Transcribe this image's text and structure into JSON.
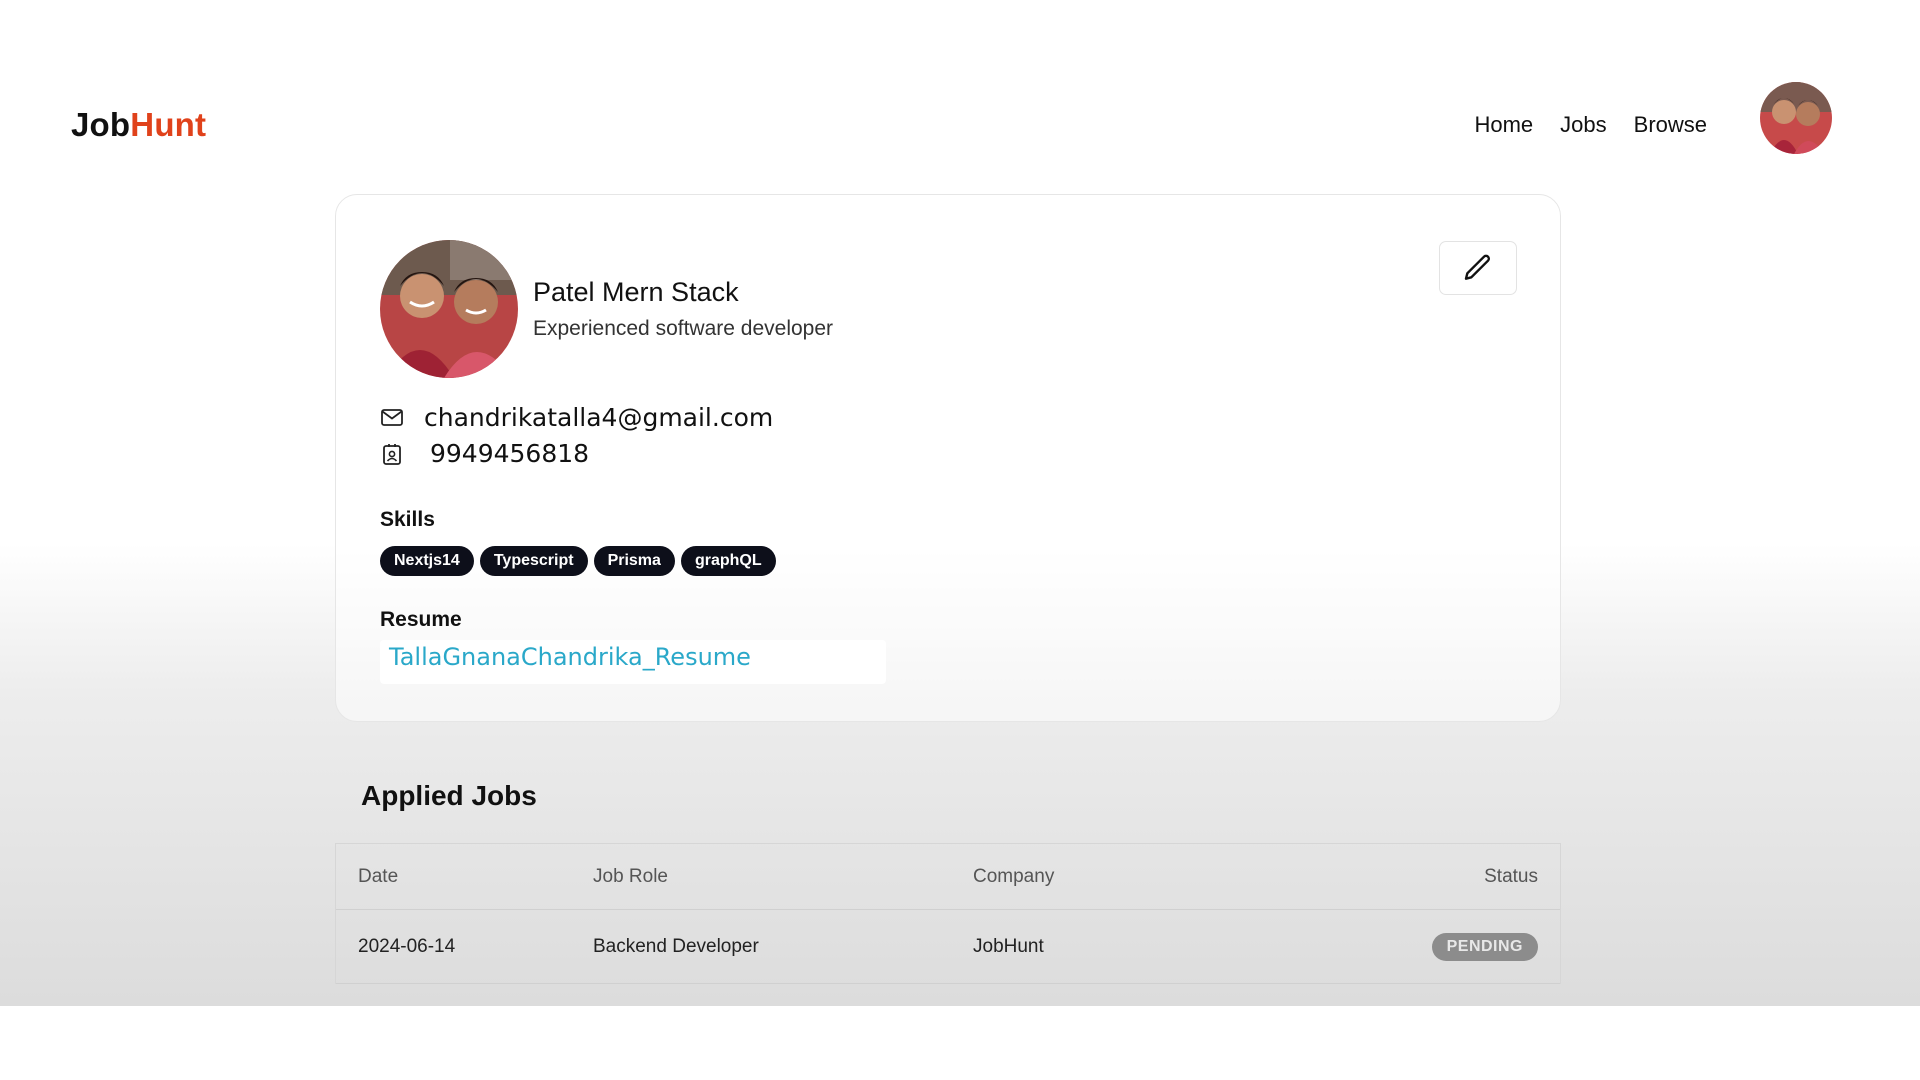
{
  "navbar": {
    "logo_part1": "Job",
    "logo_part2": "Hunt",
    "links": [
      "Home",
      "Jobs",
      "Browse"
    ]
  },
  "profile": {
    "name": "Patel Mern Stack",
    "bio": "Experienced software developer",
    "email": "chandrikatalla4@gmail.com",
    "phone": "9949456818",
    "skills_label": "Skills",
    "skills": [
      "Nextjs14",
      "Typescript",
      "Prisma",
      "graphQL"
    ],
    "resume_label": "Resume",
    "resume_file": "TallaGnanaChandrika_Resume"
  },
  "applied_jobs": {
    "title": "Applied Jobs",
    "headers": [
      "Date",
      "Job Role",
      "Company",
      "Status"
    ],
    "rows": [
      {
        "date": "2024-06-14",
        "role": "Backend Developer",
        "company": "JobHunt",
        "status": "PENDING"
      }
    ]
  },
  "colors": {
    "accent": "#e0421b",
    "badge_bg": "#0d0f1a",
    "link": "#2aa8c9",
    "status_pending": "#8c8c8c"
  }
}
